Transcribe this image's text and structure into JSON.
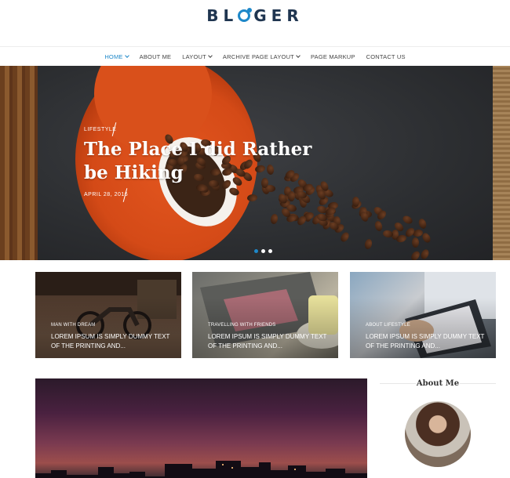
{
  "brand": {
    "logo_before": "BL",
    "logo_after": "GER",
    "accent": "#1e88c9"
  },
  "nav": {
    "items": [
      {
        "label": "HOME",
        "has_caret": true,
        "active": true
      },
      {
        "label": "ABOUT ME",
        "has_caret": false,
        "active": false
      },
      {
        "label": "LAYOUT",
        "has_caret": true,
        "active": false
      },
      {
        "label": "ARCHIVE PAGE LAYOUT",
        "has_caret": true,
        "active": false
      },
      {
        "label": "PAGE MARKUP",
        "has_caret": false,
        "active": false
      },
      {
        "label": "CONTACT US",
        "has_caret": false,
        "active": false
      }
    ]
  },
  "hero": {
    "category": "LIFESTYLE",
    "title": "The Place I did Rather be Hiking",
    "date": "APRIL 28, 2016",
    "slide_count": 3,
    "active_slide": 1
  },
  "cards": [
    {
      "category": "MAN WITH DREAM",
      "title": "LOREM IPSUM IS SIMPLY DUMMY TEXT OF THE PRINTING AND..."
    },
    {
      "category": "TRAVELLING WITH FRIENDS",
      "title": "LOREM IPSUM IS SIMPLY DUMMY TEXT OF THE PRINTING AND..."
    },
    {
      "category": "ABOUT LIFESTYLE",
      "title": "LOREM IPSUM IS SIMPLY DUMMY TEXT OF THE PRINTING AND..."
    }
  ],
  "sidebar": {
    "about_title": "About Me"
  }
}
